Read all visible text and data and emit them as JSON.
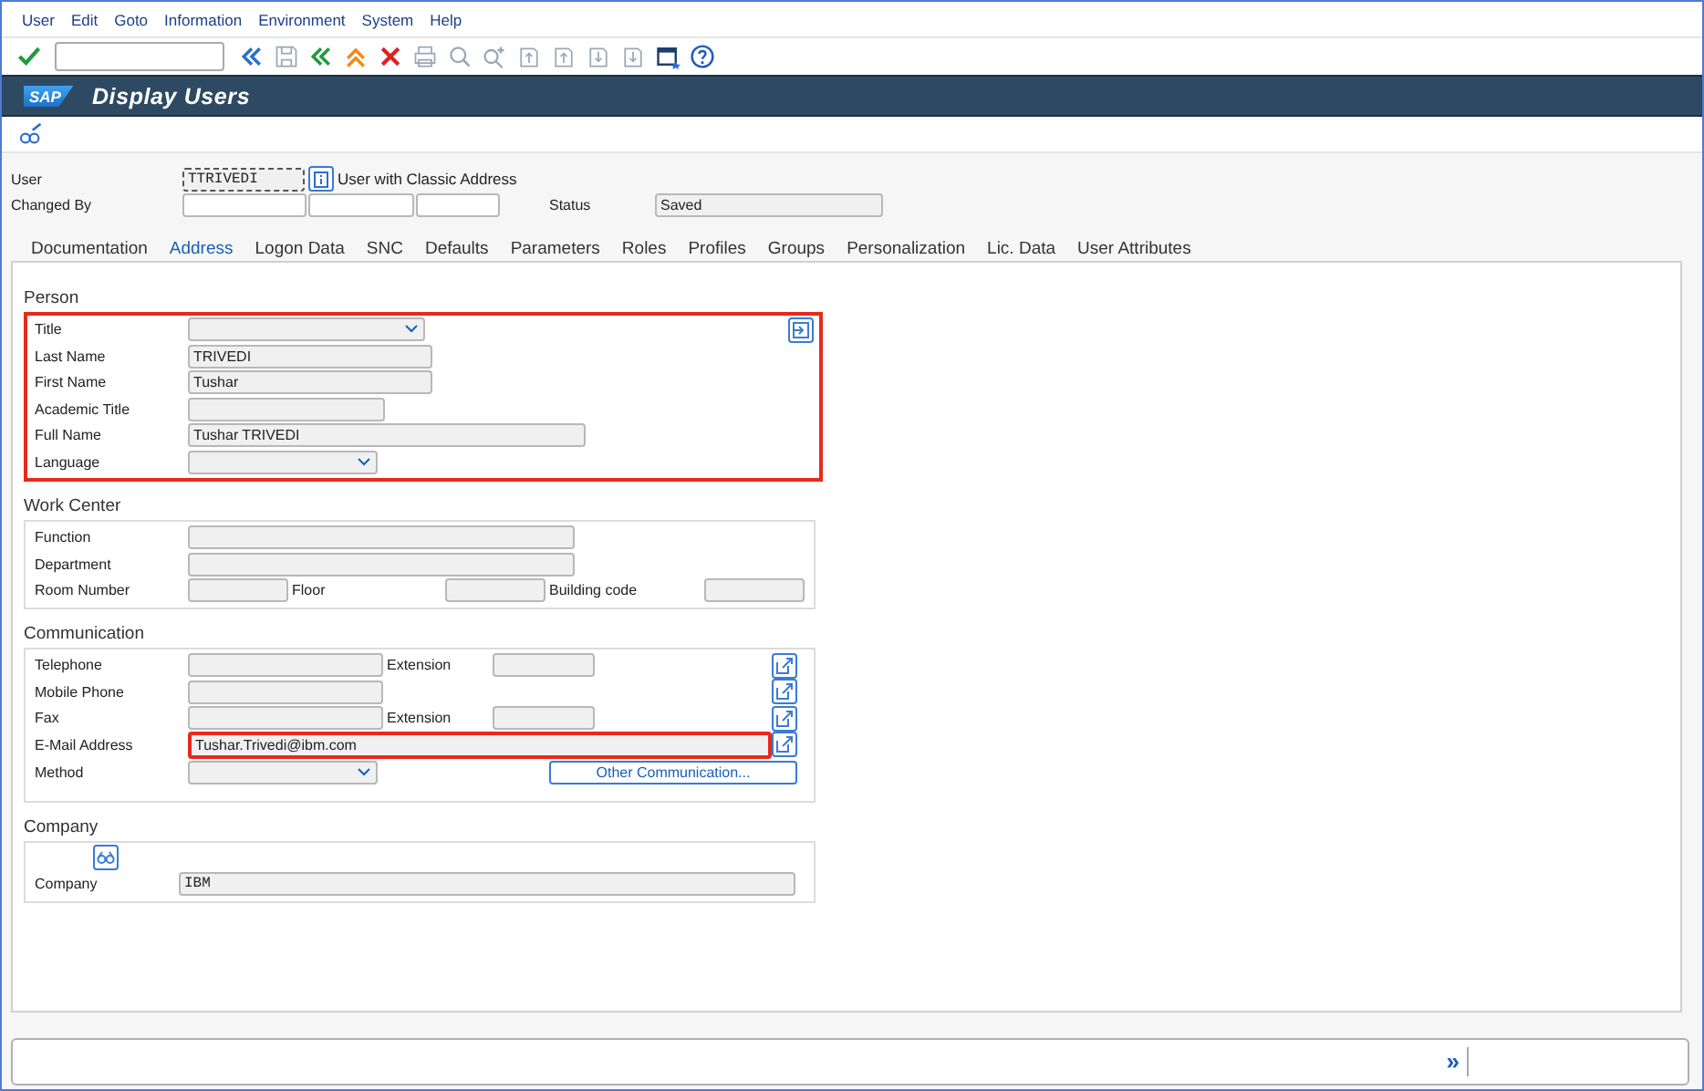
{
  "menu": [
    "User",
    "Edit",
    "Goto",
    "Information",
    "Environment",
    "System",
    "Help"
  ],
  "title_bar": {
    "logo": "SAP",
    "title": "Display Users"
  },
  "header": {
    "user": {
      "label": "User",
      "value": "TTRIVEDI"
    },
    "user_type": "User with Classic Address",
    "changed_by": {
      "label": "Changed By"
    },
    "status": {
      "label": "Status",
      "value": "Saved"
    }
  },
  "tabs": [
    {
      "label": "Documentation",
      "selected": false
    },
    {
      "label": "Address",
      "selected": true
    },
    {
      "label": "Logon Data",
      "selected": false
    },
    {
      "label": "SNC",
      "selected": false
    },
    {
      "label": "Defaults",
      "selected": false
    },
    {
      "label": "Parameters",
      "selected": false
    },
    {
      "label": "Roles",
      "selected": false
    },
    {
      "label": "Profiles",
      "selected": false
    },
    {
      "label": "Groups",
      "selected": false
    },
    {
      "label": "Personalization",
      "selected": false
    },
    {
      "label": "Lic. Data",
      "selected": false
    },
    {
      "label": "User Attributes",
      "selected": false
    }
  ],
  "sections": [
    {
      "title": "Person",
      "highlighted": true,
      "rows": [
        [
          {
            "kind": "label",
            "text": "Title"
          },
          {
            "kind": "dropdown"
          },
          {
            "kind": "icon"
          }
        ],
        [
          {
            "kind": "label",
            "text": "Last Name"
          },
          {
            "kind": "field",
            "value": "TRIVEDI",
            "highlighted": false
          }
        ],
        [
          {
            "kind": "label",
            "text": "First Name"
          },
          {
            "kind": "field",
            "value": "Tushar",
            "highlighted": false
          }
        ],
        [
          {
            "kind": "label",
            "text": "Academic Title"
          },
          {
            "kind": "field",
            "highlighted": false
          }
        ],
        [
          {
            "kind": "label",
            "text": "Full Name"
          },
          {
            "kind": "field",
            "value": "Tushar TRIVEDI",
            "highlighted": false
          }
        ],
        [
          {
            "kind": "label",
            "text": "Language"
          },
          {
            "kind": "dropdown"
          }
        ]
      ]
    },
    {
      "title": "Work Center",
      "highlighted": false,
      "rows": [
        [
          {
            "kind": "label",
            "text": "Function"
          },
          {
            "kind": "field",
            "highlighted": false
          }
        ],
        [
          {
            "kind": "label",
            "text": "Department"
          },
          {
            "kind": "field",
            "highlighted": false
          }
        ],
        [
          {
            "kind": "label",
            "text": "Room Number"
          },
          {
            "kind": "field",
            "highlighted": false
          },
          {
            "kind": "label",
            "text": "Floor"
          },
          {
            "kind": "field",
            "highlighted": false
          },
          {
            "kind": "label",
            "text": "Building code"
          },
          {
            "kind": "field",
            "highlighted": false
          }
        ]
      ]
    },
    {
      "title": "Communication",
      "highlighted": false,
      "rows": [
        [
          {
            "kind": "label",
            "text": "Telephone"
          },
          {
            "kind": "field",
            "highlighted": false
          },
          {
            "kind": "label",
            "text": "Extension"
          },
          {
            "kind": "field",
            "highlighted": false
          },
          {
            "kind": "icon"
          }
        ],
        [
          {
            "kind": "label",
            "text": "Mobile Phone"
          },
          {
            "kind": "field",
            "highlighted": false
          },
          {
            "kind": "icon"
          }
        ],
        [
          {
            "kind": "label",
            "text": "Fax"
          },
          {
            "kind": "field",
            "highlighted": false
          },
          {
            "kind": "label",
            "text": "Extension"
          },
          {
            "kind": "field",
            "highlighted": false
          },
          {
            "kind": "icon"
          }
        ],
        [
          {
            "kind": "label",
            "text": "E-Mail Address"
          },
          {
            "kind": "field",
            "value": "Tushar.Trivedi@ibm.com",
            "highlighted": true
          },
          {
            "kind": "icon"
          }
        ],
        [
          {
            "kind": "label",
            "text": "Method"
          },
          {
            "kind": "dropdown"
          },
          {
            "kind": "button",
            "text": "Other Communication..."
          }
        ]
      ]
    },
    {
      "title": "Company",
      "highlighted": false,
      "rows": [
        [
          {
            "kind": "icon"
          }
        ],
        [
          {
            "kind": "label",
            "text": "Company"
          },
          {
            "kind": "mono-field",
            "value": "IBM",
            "highlighted": false
          }
        ]
      ]
    }
  ],
  "footer": {
    "expand": "»"
  }
}
